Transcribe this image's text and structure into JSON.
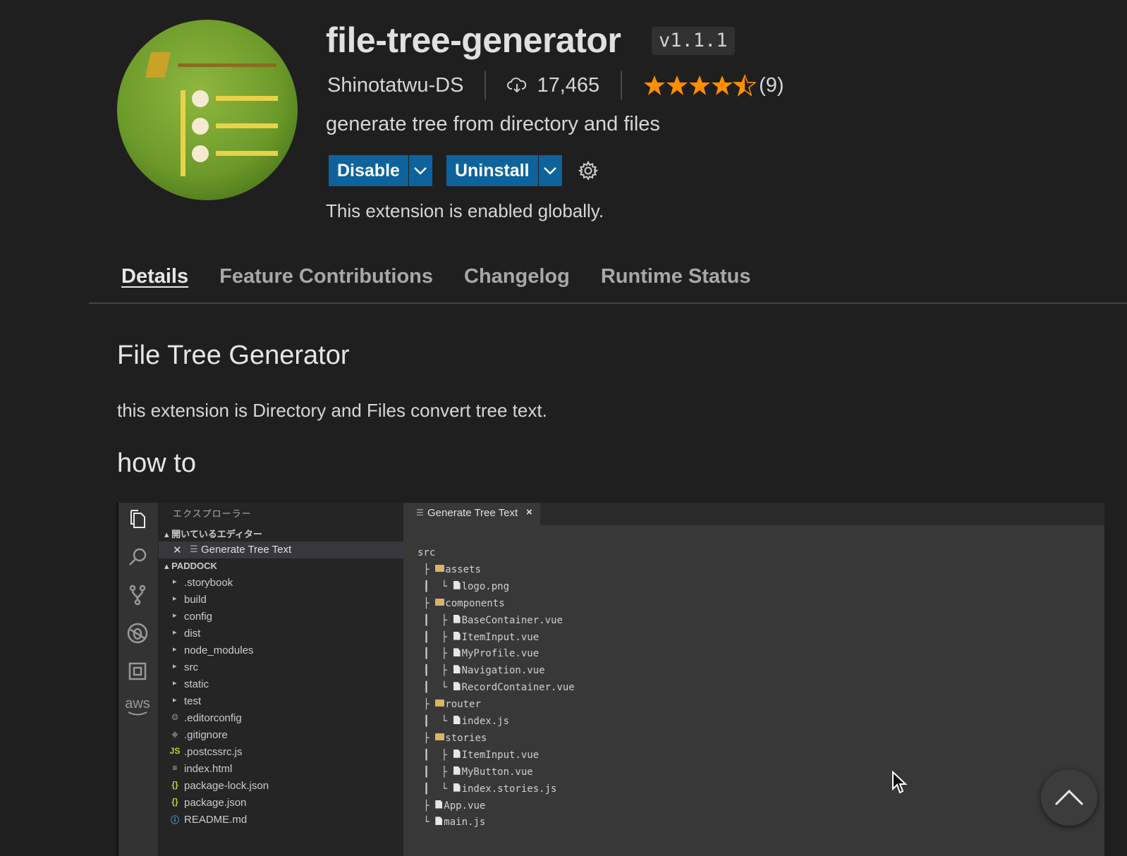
{
  "extension": {
    "name": "file-tree-generator",
    "version": "v1.1.1",
    "publisher": "Shinotatwu-DS",
    "install_count": "17,465",
    "rating_stars": 4.5,
    "rating_count": "(9)",
    "description": "generate tree from directory and files",
    "status_text": "This extension is enabled globally."
  },
  "buttons": {
    "disable": "Disable",
    "uninstall": "Uninstall"
  },
  "tabs": [
    {
      "label": "Details",
      "active": true
    },
    {
      "label": "Feature Contributions",
      "active": false
    },
    {
      "label": "Changelog",
      "active": false
    },
    {
      "label": "Runtime Status",
      "active": false
    }
  ],
  "readme": {
    "heading": "File Tree Generator",
    "intro": "this extension is Directory and Files convert tree text.",
    "subheading": "how to"
  },
  "screenshot": {
    "explorer_title": "エクスプローラー",
    "open_editors_header": "開いているエディター",
    "open_editor_item": "Generate Tree Text",
    "workspace_header": "PADDOCK",
    "files": [
      {
        "name": ".storybook",
        "kind": "folder"
      },
      {
        "name": "build",
        "kind": "folder"
      },
      {
        "name": "config",
        "kind": "folder"
      },
      {
        "name": "dist",
        "kind": "folder"
      },
      {
        "name": "node_modules",
        "kind": "folder"
      },
      {
        "name": "src",
        "kind": "folder"
      },
      {
        "name": "static",
        "kind": "folder"
      },
      {
        "name": "test",
        "kind": "folder"
      },
      {
        "name": ".editorconfig",
        "kind": "gear"
      },
      {
        "name": ".gitignore",
        "kind": "git"
      },
      {
        "name": ".postcssrc.js",
        "kind": "js"
      },
      {
        "name": "index.html",
        "kind": "html"
      },
      {
        "name": "package-lock.json",
        "kind": "json"
      },
      {
        "name": "package.json",
        "kind": "json"
      },
      {
        "name": "README.md",
        "kind": "info"
      }
    ],
    "editor_tab": "Generate Tree Text",
    "editor_tab_close": "×",
    "tree_lines": [
      {
        "prefix": "",
        "name": "src",
        "icon": "none"
      },
      {
        "prefix": " ├ ",
        "name": "assets",
        "icon": "folder"
      },
      {
        "prefix": " ┃  └ ",
        "name": "logo.png",
        "icon": "file"
      },
      {
        "prefix": " ├ ",
        "name": "components",
        "icon": "folder"
      },
      {
        "prefix": " ┃  ├ ",
        "name": "BaseContainer.vue",
        "icon": "file"
      },
      {
        "prefix": " ┃  ├ ",
        "name": "ItemInput.vue",
        "icon": "file"
      },
      {
        "prefix": " ┃  ├ ",
        "name": "MyProfile.vue",
        "icon": "file"
      },
      {
        "prefix": " ┃  ├ ",
        "name": "Navigation.vue",
        "icon": "file"
      },
      {
        "prefix": " ┃  └ ",
        "name": "RecordContainer.vue",
        "icon": "file"
      },
      {
        "prefix": " ├ ",
        "name": "router",
        "icon": "folder"
      },
      {
        "prefix": " ┃  └ ",
        "name": "index.js",
        "icon": "file"
      },
      {
        "prefix": " ├ ",
        "name": "stories",
        "icon": "folder"
      },
      {
        "prefix": " ┃  ├ ",
        "name": "ItemInput.vue",
        "icon": "file"
      },
      {
        "prefix": " ┃  ├ ",
        "name": "MyButton.vue",
        "icon": "file"
      },
      {
        "prefix": " ┃  └ ",
        "name": "index.stories.js",
        "icon": "file"
      },
      {
        "prefix": " ├ ",
        "name": "App.vue",
        "icon": "file"
      },
      {
        "prefix": " └ ",
        "name": "main.js",
        "icon": "file"
      }
    ],
    "activity_icons": [
      "files-icon",
      "search-icon",
      "source-control-icon",
      "debug-icon",
      "extensions-icon",
      "aws-icon"
    ],
    "aws_label": "aws"
  },
  "colors": {
    "background": "#1f1f1f",
    "button": "#0e639c",
    "star": "#ff8e00",
    "icon_green": "#6f9a2c"
  }
}
